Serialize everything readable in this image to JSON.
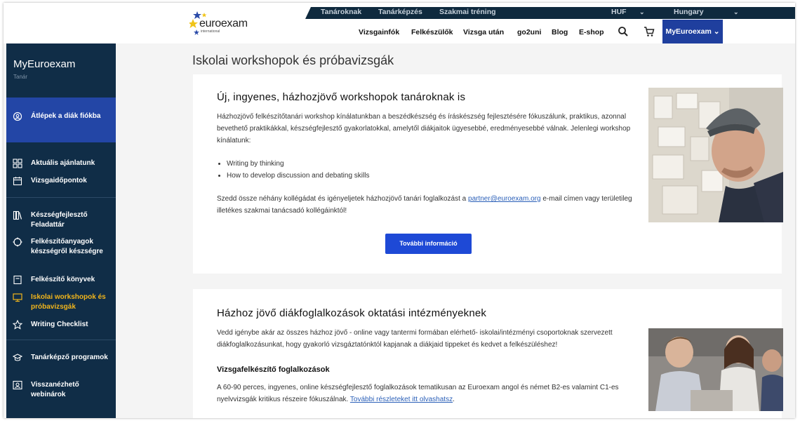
{
  "brand": {
    "name": "euroexam",
    "sub": "international"
  },
  "topbar": {
    "links": [
      "Tanároknak",
      "Tanárképzés",
      "Szakmai tréning"
    ],
    "currency": "HUF",
    "country": "Hungary"
  },
  "nav": {
    "items": [
      "Vizsgainfók",
      "Felkészülők",
      "Vizsga után",
      "go2uni",
      "Blog",
      "E-shop"
    ],
    "account": "MyEuroexam"
  },
  "sidebar": {
    "title": "MyEuroexam",
    "role": "Tanár",
    "items": [
      {
        "label": "Átlépek a diák fiókba",
        "icon": "switch-account-icon"
      },
      {
        "label": "Aktuális ajánlatunk",
        "icon": "grid-icon"
      },
      {
        "label": "Vizsgaidőpontok",
        "icon": "calendar-icon"
      },
      {
        "label": "Készségfejlesztő Feladattár",
        "icon": "library-icon"
      },
      {
        "label": "Felkészítőanyagok készségről készségre",
        "icon": "target-icon"
      },
      {
        "label": "Felkészítő könyvek",
        "icon": "book-icon"
      },
      {
        "label": "Iskolai workshopok és próbavizsgák",
        "icon": "monitor-icon"
      },
      {
        "label": "Writing Checklist",
        "icon": "star-icon"
      },
      {
        "label": "Tanárképző programok",
        "icon": "graduation-cap-icon"
      },
      {
        "label": "Visszanézhető webinárok",
        "icon": "webinar-icon"
      }
    ]
  },
  "main": {
    "page_title": "Iskolai workshopok és próbavizsgák",
    "card1": {
      "title": "Új, ingyenes, házhozjövő workshopok tanároknak is",
      "para1": "Házhozjövő felkészítőtanári workshop kínálatunkban a beszédkészség és íráskészség fejlesztésére fókuszálunk, praktikus, azonnal bevethető praktikákkal, készségfejlesztő gyakorlatokkal, amelytől diákjaitok ügyesebbé, eredményesebbé válnak. Jelenlegi workshop kínálatunk:",
      "bullets": [
        "Writing by thinking",
        "How to develop discussion and debating skills"
      ],
      "para2_before": "Szedd össze néhány kollégádat és igényeljetek házhozjövő tanári foglalkozást a ",
      "email": "partner@euroexam.org",
      "para2_after": " e-mail címen vagy területileg illetékes szakmai tanácsadó kollégáinktól!",
      "button": "További információ"
    },
    "card2": {
      "title": "Házhoz jövő diákfoglalkozások oktatási intézményeknek",
      "para1": "Vedd igénybe akár az összes házhoz jövő - online vagy tantermi formában elérhető- iskolai/intézményi csoportoknak szervezett diákfoglalkozásunkat, hogy gyakorló vizsgáztatónktól kapjanak a diákjaid tippeket és kedvet a felkészüléshez!",
      "subtitle": "Vizsgafelkészítő foglalkozások",
      "para2_before": "A 60-90 perces, ingyenes, online készségfejlesztő foglalkozások tematikusan az Euroexam angol és német B2-es valamint C1-es nyelvvizsgák kritikus részeire fókuszálnak. ",
      "link": "További részleteket itt olvashatsz",
      "para2_after": "."
    }
  },
  "colors": {
    "sidebar": "#102d47",
    "active": "#2346a6",
    "highlight": "#f1b51c",
    "button": "#1e49d6",
    "link": "#2a5fb8"
  }
}
